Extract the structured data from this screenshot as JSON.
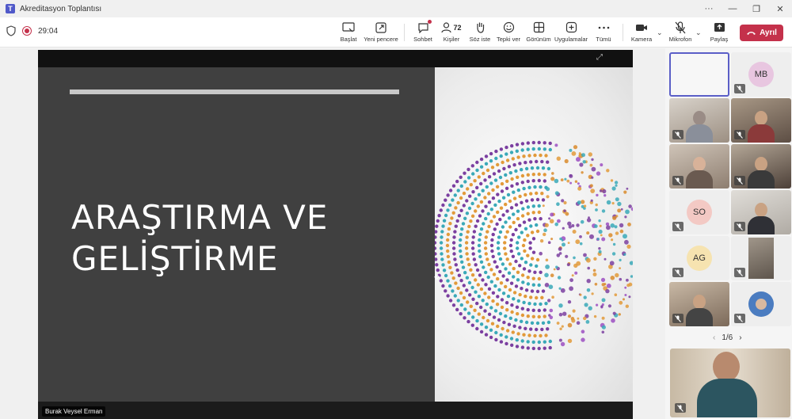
{
  "window": {
    "title": "Akreditasyon Toplantısı",
    "controls": [
      "···",
      "—",
      "❐",
      "✕"
    ]
  },
  "toolbar": {
    "timer": "29:04",
    "items": [
      {
        "label": "Başlat",
        "icon": "start-icon"
      },
      {
        "label": "Yeni pencere",
        "icon": "new-window-icon"
      },
      {
        "label": "Sohbet",
        "icon": "chat-icon"
      },
      {
        "label": "Kişiler",
        "icon": "people-icon",
        "count": "72"
      },
      {
        "label": "Söz iste",
        "icon": "raise-hand-icon"
      },
      {
        "label": "Tepki ver",
        "icon": "react-icon"
      },
      {
        "label": "Görünüm",
        "icon": "view-icon"
      },
      {
        "label": "Uygulamalar",
        "icon": "apps-icon"
      },
      {
        "label": "Tümü",
        "icon": "more-icon"
      },
      {
        "label": "Kamera",
        "icon": "camera-icon"
      },
      {
        "label": "Mikrofon",
        "icon": "mic-off-icon"
      },
      {
        "label": "Paylaş",
        "icon": "share-icon"
      }
    ],
    "leave_label": "Ayrıl",
    "colors": {
      "leave": "#c4314b",
      "accent": "#5b5fc7"
    }
  },
  "share": {
    "presenter": "Burak Veysel Erman",
    "slide_title_line1": "ARAŞTIRMA VE",
    "slide_title_line2": "GELİŞTİRME"
  },
  "participants": {
    "initials": [
      "MB",
      "SO",
      "AG"
    ],
    "pager": "1/6"
  }
}
